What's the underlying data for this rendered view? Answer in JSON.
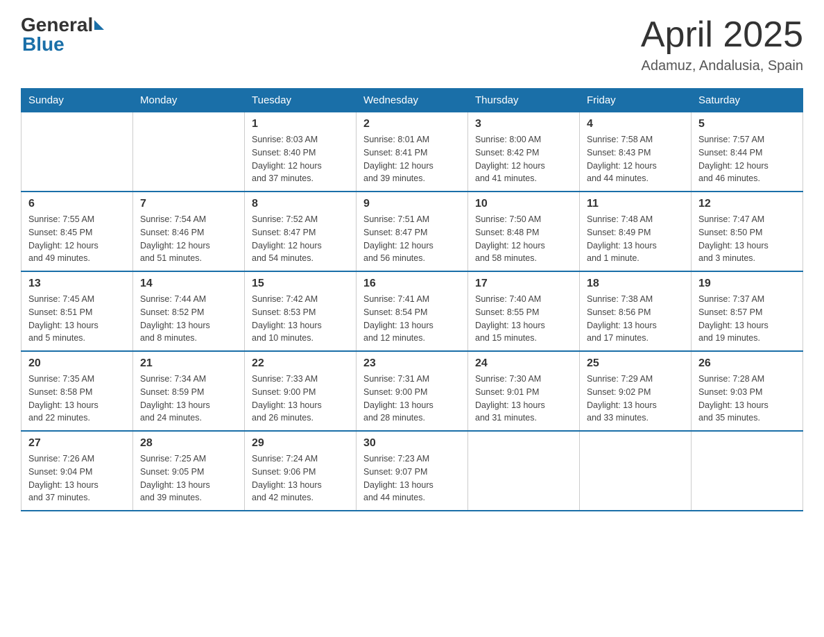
{
  "header": {
    "logo_general": "General",
    "logo_blue": "Blue",
    "title": "April 2025",
    "subtitle": "Adamuz, Andalusia, Spain"
  },
  "weekdays": [
    "Sunday",
    "Monday",
    "Tuesday",
    "Wednesday",
    "Thursday",
    "Friday",
    "Saturday"
  ],
  "weeks": [
    [
      {
        "day": "",
        "info": ""
      },
      {
        "day": "",
        "info": ""
      },
      {
        "day": "1",
        "info": "Sunrise: 8:03 AM\nSunset: 8:40 PM\nDaylight: 12 hours\nand 37 minutes."
      },
      {
        "day": "2",
        "info": "Sunrise: 8:01 AM\nSunset: 8:41 PM\nDaylight: 12 hours\nand 39 minutes."
      },
      {
        "day": "3",
        "info": "Sunrise: 8:00 AM\nSunset: 8:42 PM\nDaylight: 12 hours\nand 41 minutes."
      },
      {
        "day": "4",
        "info": "Sunrise: 7:58 AM\nSunset: 8:43 PM\nDaylight: 12 hours\nand 44 minutes."
      },
      {
        "day": "5",
        "info": "Sunrise: 7:57 AM\nSunset: 8:44 PM\nDaylight: 12 hours\nand 46 minutes."
      }
    ],
    [
      {
        "day": "6",
        "info": "Sunrise: 7:55 AM\nSunset: 8:45 PM\nDaylight: 12 hours\nand 49 minutes."
      },
      {
        "day": "7",
        "info": "Sunrise: 7:54 AM\nSunset: 8:46 PM\nDaylight: 12 hours\nand 51 minutes."
      },
      {
        "day": "8",
        "info": "Sunrise: 7:52 AM\nSunset: 8:47 PM\nDaylight: 12 hours\nand 54 minutes."
      },
      {
        "day": "9",
        "info": "Sunrise: 7:51 AM\nSunset: 8:47 PM\nDaylight: 12 hours\nand 56 minutes."
      },
      {
        "day": "10",
        "info": "Sunrise: 7:50 AM\nSunset: 8:48 PM\nDaylight: 12 hours\nand 58 minutes."
      },
      {
        "day": "11",
        "info": "Sunrise: 7:48 AM\nSunset: 8:49 PM\nDaylight: 13 hours\nand 1 minute."
      },
      {
        "day": "12",
        "info": "Sunrise: 7:47 AM\nSunset: 8:50 PM\nDaylight: 13 hours\nand 3 minutes."
      }
    ],
    [
      {
        "day": "13",
        "info": "Sunrise: 7:45 AM\nSunset: 8:51 PM\nDaylight: 13 hours\nand 5 minutes."
      },
      {
        "day": "14",
        "info": "Sunrise: 7:44 AM\nSunset: 8:52 PM\nDaylight: 13 hours\nand 8 minutes."
      },
      {
        "day": "15",
        "info": "Sunrise: 7:42 AM\nSunset: 8:53 PM\nDaylight: 13 hours\nand 10 minutes."
      },
      {
        "day": "16",
        "info": "Sunrise: 7:41 AM\nSunset: 8:54 PM\nDaylight: 13 hours\nand 12 minutes."
      },
      {
        "day": "17",
        "info": "Sunrise: 7:40 AM\nSunset: 8:55 PM\nDaylight: 13 hours\nand 15 minutes."
      },
      {
        "day": "18",
        "info": "Sunrise: 7:38 AM\nSunset: 8:56 PM\nDaylight: 13 hours\nand 17 minutes."
      },
      {
        "day": "19",
        "info": "Sunrise: 7:37 AM\nSunset: 8:57 PM\nDaylight: 13 hours\nand 19 minutes."
      }
    ],
    [
      {
        "day": "20",
        "info": "Sunrise: 7:35 AM\nSunset: 8:58 PM\nDaylight: 13 hours\nand 22 minutes."
      },
      {
        "day": "21",
        "info": "Sunrise: 7:34 AM\nSunset: 8:59 PM\nDaylight: 13 hours\nand 24 minutes."
      },
      {
        "day": "22",
        "info": "Sunrise: 7:33 AM\nSunset: 9:00 PM\nDaylight: 13 hours\nand 26 minutes."
      },
      {
        "day": "23",
        "info": "Sunrise: 7:31 AM\nSunset: 9:00 PM\nDaylight: 13 hours\nand 28 minutes."
      },
      {
        "day": "24",
        "info": "Sunrise: 7:30 AM\nSunset: 9:01 PM\nDaylight: 13 hours\nand 31 minutes."
      },
      {
        "day": "25",
        "info": "Sunrise: 7:29 AM\nSunset: 9:02 PM\nDaylight: 13 hours\nand 33 minutes."
      },
      {
        "day": "26",
        "info": "Sunrise: 7:28 AM\nSunset: 9:03 PM\nDaylight: 13 hours\nand 35 minutes."
      }
    ],
    [
      {
        "day": "27",
        "info": "Sunrise: 7:26 AM\nSunset: 9:04 PM\nDaylight: 13 hours\nand 37 minutes."
      },
      {
        "day": "28",
        "info": "Sunrise: 7:25 AM\nSunset: 9:05 PM\nDaylight: 13 hours\nand 39 minutes."
      },
      {
        "day": "29",
        "info": "Sunrise: 7:24 AM\nSunset: 9:06 PM\nDaylight: 13 hours\nand 42 minutes."
      },
      {
        "day": "30",
        "info": "Sunrise: 7:23 AM\nSunset: 9:07 PM\nDaylight: 13 hours\nand 44 minutes."
      },
      {
        "day": "",
        "info": ""
      },
      {
        "day": "",
        "info": ""
      },
      {
        "day": "",
        "info": ""
      }
    ]
  ]
}
